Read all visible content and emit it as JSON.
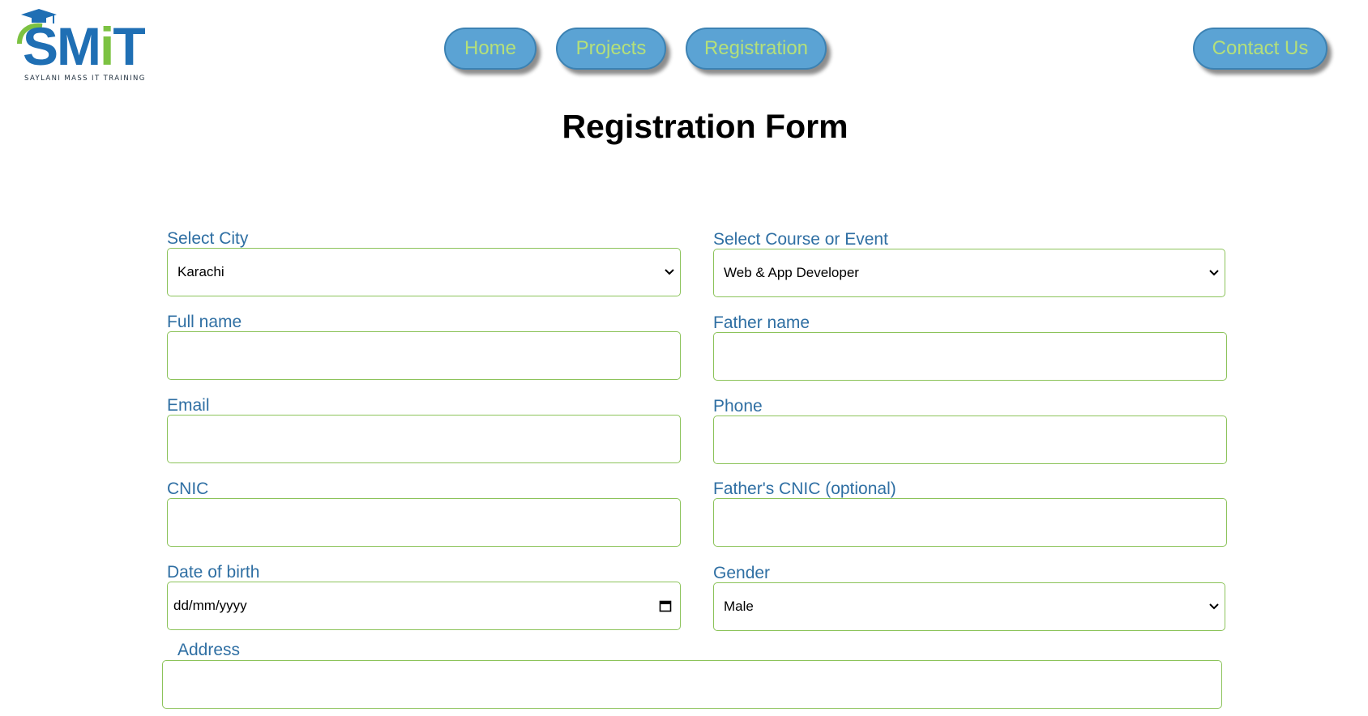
{
  "brand": {
    "name_prefix": "SM",
    "name_i": "i",
    "name_suffix": "T",
    "tagline": "SAYLANI MASS IT TRAINING",
    "colors": {
      "blue": "#1f6fb4",
      "green": "#7cc242"
    }
  },
  "nav": {
    "items": [
      {
        "label": "Home"
      },
      {
        "label": "Projects"
      },
      {
        "label": "Registration"
      },
      {
        "label": "Contact Us"
      }
    ],
    "colors": {
      "button_bg": "#5ba3d4",
      "button_text": "#b5e07a"
    }
  },
  "page": {
    "title": "Registration Form"
  },
  "form": {
    "city": {
      "label": "Select City",
      "value": "Karachi"
    },
    "course": {
      "label": "Select Course or Event",
      "value": "Web & App Developer"
    },
    "full_name": {
      "label": "Full name",
      "value": ""
    },
    "father_name": {
      "label": "Father name",
      "value": ""
    },
    "email": {
      "label": "Email",
      "value": ""
    },
    "phone": {
      "label": "Phone",
      "value": ""
    },
    "cnic": {
      "label": "CNIC",
      "value": ""
    },
    "father_cnic": {
      "label": "Father's CNIC (optional)",
      "value": ""
    },
    "dob": {
      "label": "Date of birth",
      "placeholder": "dd/mm/yyyy"
    },
    "gender": {
      "label": "Gender",
      "value": "Male"
    },
    "address": {
      "label": "Address",
      "value": ""
    },
    "colors": {
      "label": "#2f6fa3",
      "border": "#8cc35a"
    }
  },
  "icons": {
    "select": "chevron-down-icon",
    "date": "calendar-icon"
  }
}
